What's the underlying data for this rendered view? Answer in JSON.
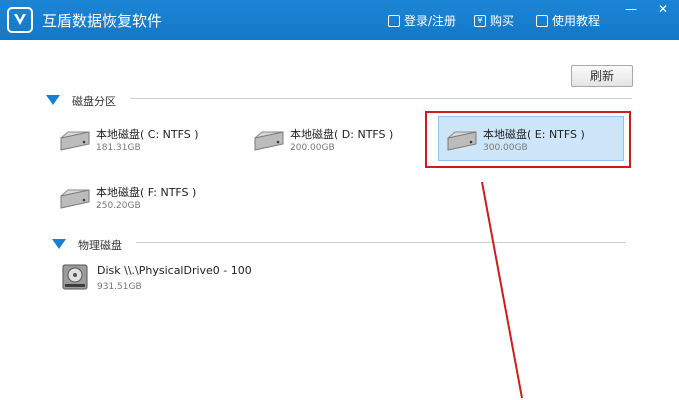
{
  "app": {
    "title": "互盾数据恢复软件"
  },
  "toolbar": {
    "login": "登录/注册",
    "buy": "购买",
    "buy_icon": "¥",
    "tutorial": "使用教程"
  },
  "window_controls": {
    "minimize": "—",
    "close": "✕"
  },
  "refresh_label": "刷新",
  "partitions": {
    "title": "磁盘分区",
    "drives": [
      {
        "name": "本地磁盘( C: NTFS )",
        "size": "181.31GB"
      },
      {
        "name": "本地磁盘( D: NTFS )",
        "size": "200.00GB"
      },
      {
        "name": "本地磁盘( E: NTFS )",
        "size": "300.00GB",
        "selected": true
      },
      {
        "name": "本地磁盘( F: NTFS )",
        "size": "250.20GB"
      }
    ]
  },
  "physical": {
    "title": "物理磁盘",
    "disks": [
      {
        "name": "Disk \\\\.\\PhysicalDrive0 - 100",
        "size": "931.51GB"
      }
    ]
  },
  "colors": {
    "titlebar": "#1577c6",
    "accent": "#1a7fd2",
    "highlight": "#cde6fa",
    "annotation": "#cc1d1d"
  }
}
